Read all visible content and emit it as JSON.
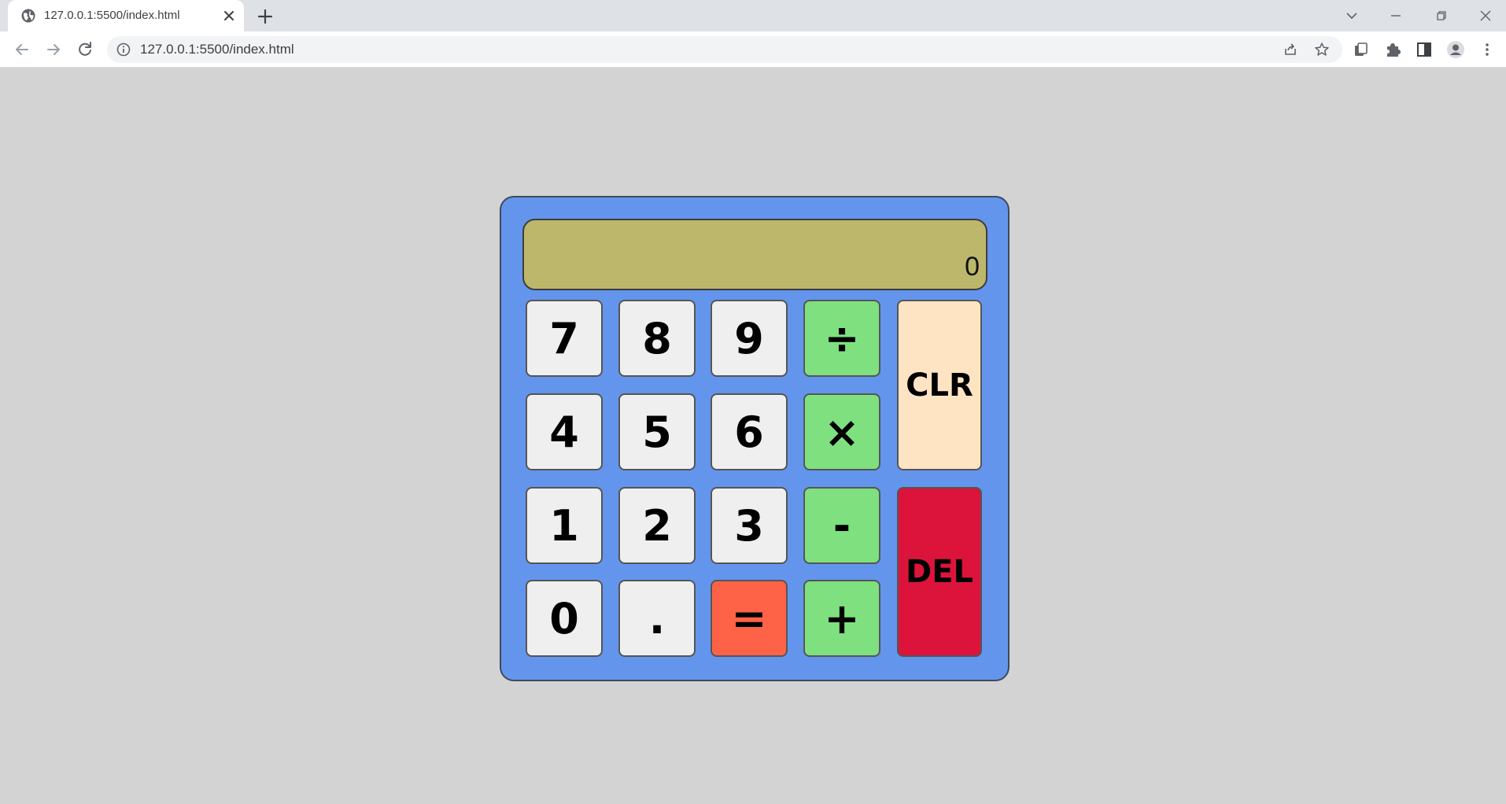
{
  "browser": {
    "tab_title": "127.0.0.1:5500/index.html",
    "url": "127.0.0.1:5500/index.html"
  },
  "calculator": {
    "display": "0",
    "keys": {
      "seven": "7",
      "eight": "8",
      "nine": "9",
      "divide": "÷",
      "four": "4",
      "five": "5",
      "six": "6",
      "multiply": "×",
      "one": "1",
      "two": "2",
      "three": "3",
      "subtract": "-",
      "zero": "0",
      "decimal": ".",
      "equals": "=",
      "add": "+",
      "clear": "CLR",
      "delete": "DEL"
    }
  },
  "colors": {
    "page_background": "#d3d3d3",
    "calculator_body": "#6495ed",
    "display_background": "#bdb76b",
    "number_key": "#efefef",
    "operator_key": "#7fe07f",
    "equals_key": "#ff6347",
    "clear_key": "#ffe4c4",
    "delete_key": "#dc143c"
  },
  "icons": {
    "tab_favicon": "globe-icon",
    "tab_close": "close-icon",
    "new_tab": "plus-icon",
    "back": "back-arrow-icon",
    "forward": "forward-arrow-icon",
    "reload": "reload-icon",
    "site_info": "info-icon",
    "share": "share-icon",
    "bookmark": "star-icon",
    "extension_pages": "pages-icon",
    "extensions": "puzzle-icon",
    "side_panel": "side-panel-icon",
    "profile": "profile-icon",
    "menu": "kebab-menu-icon"
  }
}
